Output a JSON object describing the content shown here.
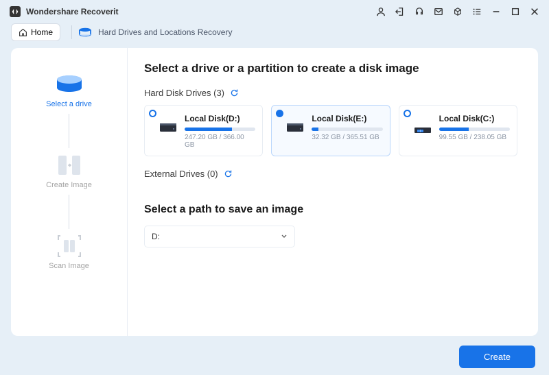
{
  "app": {
    "title": "Wondershare Recoverit"
  },
  "toolbar": {
    "home_label": "Home"
  },
  "breadcrumb": {
    "text": "Hard Drives and Locations Recovery"
  },
  "sidebar": {
    "steps": [
      {
        "label": "Select a drive"
      },
      {
        "label": "Create Image"
      },
      {
        "label": "Scan Image"
      }
    ]
  },
  "content": {
    "heading": "Select a drive or a partition to create a disk image",
    "hard_disk_label": "Hard Disk Drives (3)",
    "external_label": "External Drives (0)",
    "drives": [
      {
        "name": "Local Disk(D:)",
        "size": "247.20 GB / 366.00 GB",
        "fill": 67,
        "selected": false,
        "type": "disk"
      },
      {
        "name": "Local Disk(E:)",
        "size": "32.32 GB / 365.51 GB",
        "fill": 9,
        "selected": true,
        "type": "disk"
      },
      {
        "name": "Local Disk(C:)",
        "size": "99.55 GB / 238.05 GB",
        "fill": 42,
        "selected": false,
        "type": "windows"
      }
    ],
    "save_heading": "Select a path to save an image",
    "save_path": "D:"
  },
  "footer": {
    "create_label": "Create"
  }
}
